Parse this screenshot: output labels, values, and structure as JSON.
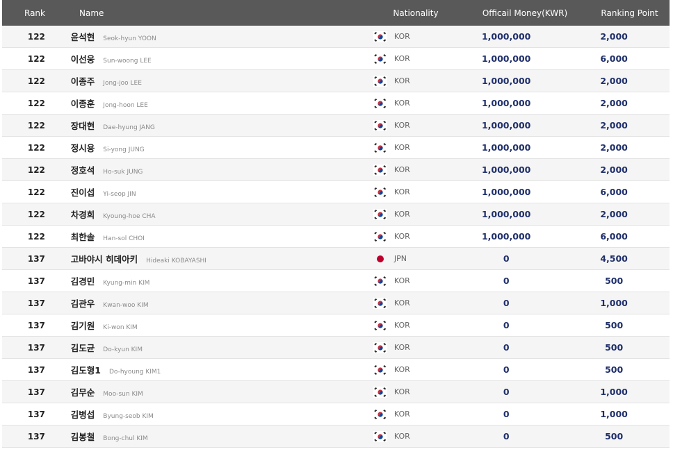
{
  "header": {
    "rank": "Rank",
    "name": "Name",
    "nationality": "Nationality",
    "money": "Officail Money(KWR)",
    "point": "Ranking Point"
  },
  "rows": [
    {
      "rank": "122",
      "kname": "윤석현",
      "ename": "Seok-hyun YOON",
      "flag": "kor-flag-icon",
      "nat": "KOR",
      "money": "1,000,000",
      "point": "2,000"
    },
    {
      "rank": "122",
      "kname": "이선웅",
      "ename": "Sun-woong LEE",
      "flag": "kor-flag-icon",
      "nat": "KOR",
      "money": "1,000,000",
      "point": "6,000"
    },
    {
      "rank": "122",
      "kname": "이종주",
      "ename": "Jong-joo LEE",
      "flag": "kor-flag-icon",
      "nat": "KOR",
      "money": "1,000,000",
      "point": "2,000"
    },
    {
      "rank": "122",
      "kname": "이종훈",
      "ename": "Jong-hoon LEE",
      "flag": "kor-flag-icon",
      "nat": "KOR",
      "money": "1,000,000",
      "point": "2,000"
    },
    {
      "rank": "122",
      "kname": "장대현",
      "ename": "Dae-hyung JANG",
      "flag": "kor-flag-icon",
      "nat": "KOR",
      "money": "1,000,000",
      "point": "2,000"
    },
    {
      "rank": "122",
      "kname": "정시용",
      "ename": "Si-yong JUNG",
      "flag": "kor-flag-icon",
      "nat": "KOR",
      "money": "1,000,000",
      "point": "2,000"
    },
    {
      "rank": "122",
      "kname": "정호석",
      "ename": "Ho-suk JUNG",
      "flag": "kor-flag-icon",
      "nat": "KOR",
      "money": "1,000,000",
      "point": "2,000"
    },
    {
      "rank": "122",
      "kname": "진이섭",
      "ename": "Yi-seop JIN",
      "flag": "kor-flag-icon",
      "nat": "KOR",
      "money": "1,000,000",
      "point": "6,000"
    },
    {
      "rank": "122",
      "kname": "차경희",
      "ename": "Kyoung-hoe CHA",
      "flag": "kor-flag-icon",
      "nat": "KOR",
      "money": "1,000,000",
      "point": "2,000"
    },
    {
      "rank": "122",
      "kname": "최한솔",
      "ename": "Han-sol CHOI",
      "flag": "kor-flag-icon",
      "nat": "KOR",
      "money": "1,000,000",
      "point": "6,000"
    },
    {
      "rank": "137",
      "kname": "고바야시 히데아키",
      "ename": "Hideaki KOBAYASHI",
      "flag": "jpn-flag-icon",
      "nat": "JPN",
      "money": "0",
      "point": "4,500"
    },
    {
      "rank": "137",
      "kname": "김경민",
      "ename": "Kyung-min KIM",
      "flag": "kor-flag-icon",
      "nat": "KOR",
      "money": "0",
      "point": "500"
    },
    {
      "rank": "137",
      "kname": "김관우",
      "ename": "Kwan-woo KIM",
      "flag": "kor-flag-icon",
      "nat": "KOR",
      "money": "0",
      "point": "1,000"
    },
    {
      "rank": "137",
      "kname": "김기원",
      "ename": "Ki-won KIM",
      "flag": "kor-flag-icon",
      "nat": "KOR",
      "money": "0",
      "point": "500"
    },
    {
      "rank": "137",
      "kname": "김도균",
      "ename": "Do-kyun KIM",
      "flag": "kor-flag-icon",
      "nat": "KOR",
      "money": "0",
      "point": "500"
    },
    {
      "rank": "137",
      "kname": "김도형1",
      "ename": "Do-hyoung KIM1",
      "flag": "kor-flag-icon",
      "nat": "KOR",
      "money": "0",
      "point": "500"
    },
    {
      "rank": "137",
      "kname": "김무순",
      "ename": "Moo-sun KIM",
      "flag": "kor-flag-icon",
      "nat": "KOR",
      "money": "0",
      "point": "1,000"
    },
    {
      "rank": "137",
      "kname": "김병섭",
      "ename": "Byung-seob KIM",
      "flag": "kor-flag-icon",
      "nat": "KOR",
      "money": "0",
      "point": "1,000"
    },
    {
      "rank": "137",
      "kname": "김봉철",
      "ename": "Bong-chul KIM",
      "flag": "kor-flag-icon",
      "nat": "KOR",
      "money": "0",
      "point": "500"
    }
  ],
  "colors": {
    "header_bg": "#595959",
    "value_text": "#1f2f6b",
    "row_alt_bg": "#f5f5f5"
  }
}
